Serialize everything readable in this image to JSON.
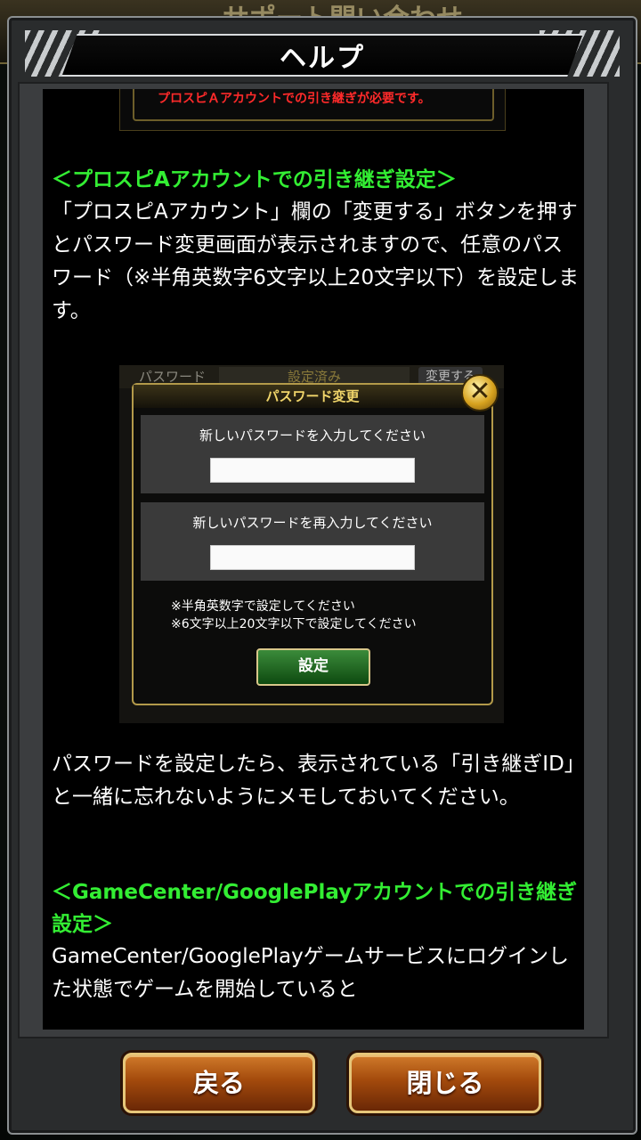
{
  "background": {
    "title_partial": "サポート問い合わせ"
  },
  "dialog": {
    "title": "ヘルプ"
  },
  "content": {
    "top_image_text": "プロスピＡアカウントでの引き継ぎが必要です。",
    "section1_heading": "＜プロスピAアカウントでの引き継ぎ設定＞",
    "section1_body": "「プロスピAアカウント」欄の「変更する」ボタンを押すとパスワード変更画面が表示されますので、任意のパスワード（※半角英数字6文字以上20文字以下）を設定します。",
    "screenshot": {
      "row_label": "パスワード",
      "row_value": "設定済み",
      "row_button": "変更する",
      "dialog_title": "パスワード変更",
      "close_glyph": "✕",
      "field1_label": "新しいパスワードを入力してください",
      "field2_label": "新しいパスワードを再入力してください",
      "note1": "※半角英数字で設定してください",
      "note2": "※6文字以上20文字以下で設定してください",
      "set_button": "設定"
    },
    "section1_after": "パスワードを設定したら、表示されている「引き継ぎID」と一緒に忘れないようにメモしておいてください。",
    "section2_heading": "＜GameCenter/GooglePlayアカウントでの引き継ぎ設定＞",
    "section2_body": "GameCenter/GooglePlayゲームサービスにログインした状態でゲームを開始していると"
  },
  "buttons": {
    "back": "戻る",
    "close": "閉じる"
  },
  "colors": {
    "heading_green": "#33ee33",
    "notice_red": "#ff2a2a",
    "button_orange": "#a34a0c"
  }
}
